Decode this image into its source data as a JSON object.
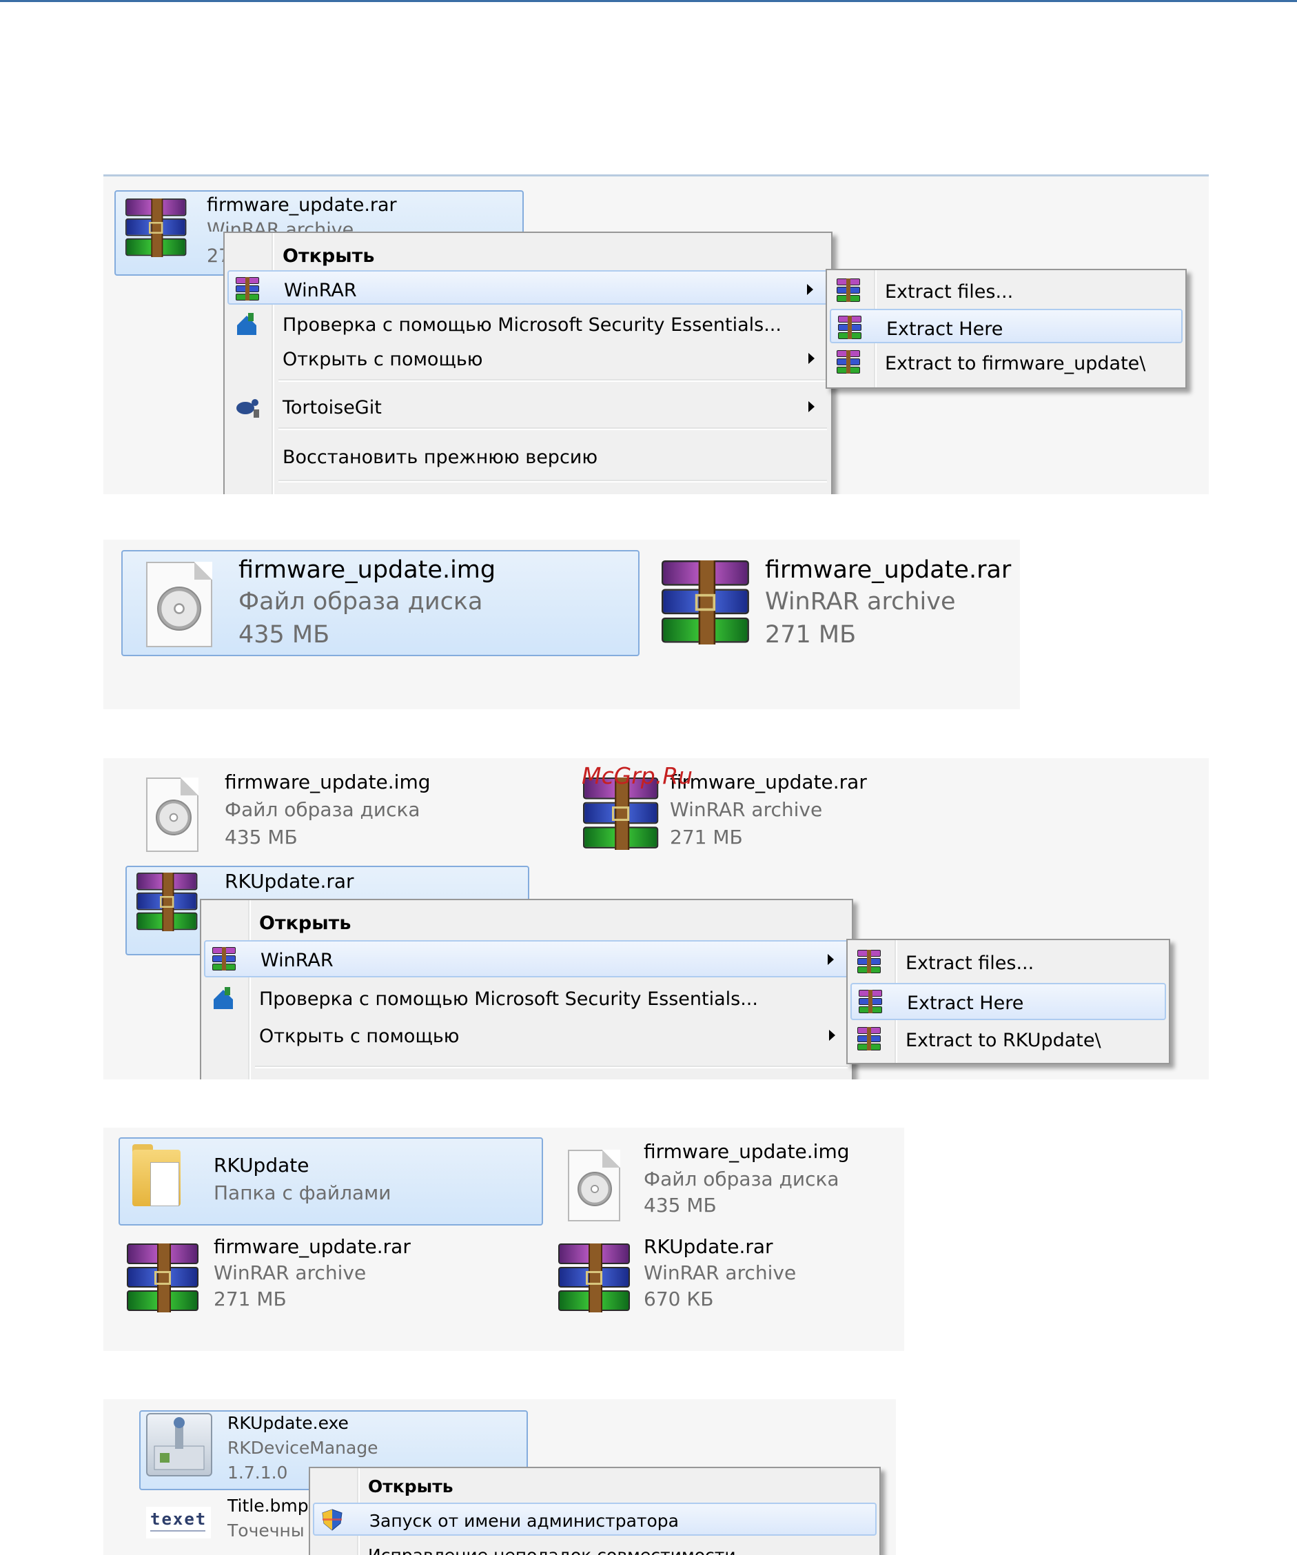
{
  "watermark": "McGrp.Ru",
  "panel1": {
    "file_name": "firmware_update.rar",
    "file_type": "WinRAR archive",
    "file_size": "27",
    "menu": {
      "open": "Открыть",
      "winrar": "WinRAR",
      "mse": "Проверка с помощью Microsoft Security Essentials...",
      "open_with": "Открыть с помощью",
      "tortoisegit": "TortoiseGit",
      "restore": "Восстановить прежнюю версию"
    },
    "submenu": {
      "extract_files": "Extract files...",
      "extract_here": "Extract Here",
      "extract_to": "Extract to firmware_update\\"
    }
  },
  "panel2": {
    "img_name": "firmware_update.img",
    "img_type": "Файл образа диска",
    "img_size": "435 МБ",
    "rar_name": "firmware_update.rar",
    "rar_type": "WinRAR archive",
    "rar_size": "271 МБ"
  },
  "panel3": {
    "img_name": "firmware_update.img",
    "img_type": "Файл образа диска",
    "img_size": "435 МБ",
    "rar_name": "firmware_update.rar",
    "rar_type": "WinRAR archive",
    "rar_size": "271 МБ",
    "rk_name": "RKUpdate.rar",
    "menu": {
      "open": "Открыть",
      "winrar": "WinRAR",
      "mse": "Проверка с помощью Microsoft Security Essentials...",
      "open_with": "Открыть с помощью"
    },
    "submenu": {
      "extract_files": "Extract files...",
      "extract_here": "Extract Here",
      "extract_to": "Extract to RKUpdate\\"
    }
  },
  "panel4": {
    "folder_name": "RKUpdate",
    "folder_type": "Папка с файлами",
    "img_name": "firmware_update.img",
    "img_type": "Файл образа диска",
    "img_size": "435 МБ",
    "rar_name": "firmware_update.rar",
    "rar_type": "WinRAR archive",
    "rar_size": "271 МБ",
    "rk_name": "RKUpdate.rar",
    "rk_type": "WinRAR archive",
    "rk_size": "670 КБ"
  },
  "panel5": {
    "exe_name": "RKUpdate.exe",
    "exe_desc": "RKDeviceManage",
    "exe_version": "1.7.1.0",
    "bmp_name": "Title.bmp",
    "bmp_type": "Точечны",
    "texet_logo": "texet",
    "menu": {
      "open": "Открыть",
      "run_as_admin": "Запуск от имени администратора",
      "compat": "Исправление неполадок совместимости"
    }
  }
}
